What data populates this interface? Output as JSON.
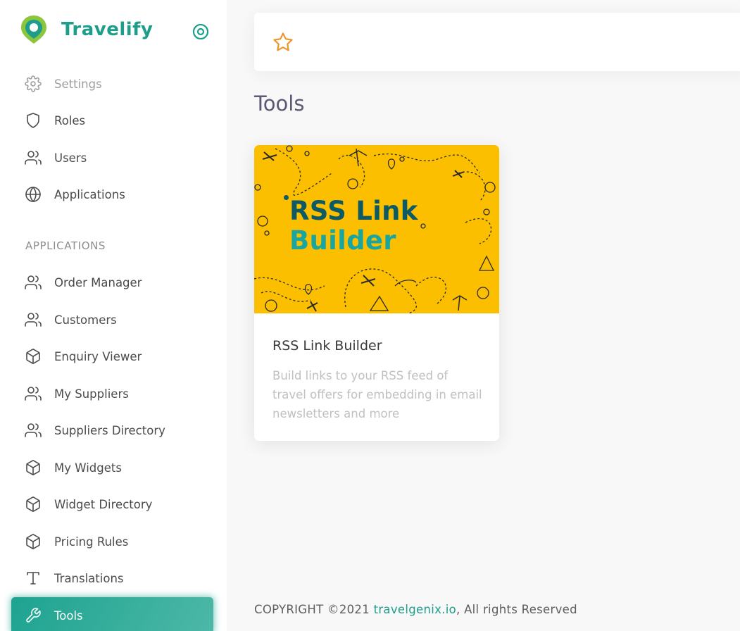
{
  "brand": {
    "name": "Travelify"
  },
  "colors": {
    "accent": "#1e9e8a",
    "card_image_bg": "#fbbf00",
    "star": "#f0932b"
  },
  "sidebar": {
    "section_header": "APPLICATIONS",
    "items": [
      {
        "label": "Settings",
        "icon": "gear-icon"
      },
      {
        "label": "Roles",
        "icon": "shield-icon"
      },
      {
        "label": "Users",
        "icon": "users-icon"
      },
      {
        "label": "Applications",
        "icon": "globe-icon"
      },
      {
        "label": "Order Manager",
        "icon": "users-icon"
      },
      {
        "label": "Customers",
        "icon": "users-icon"
      },
      {
        "label": "Enquiry Viewer",
        "icon": "box-icon"
      },
      {
        "label": "My Suppliers",
        "icon": "users-icon"
      },
      {
        "label": "Suppliers Directory",
        "icon": "users-icon"
      },
      {
        "label": "My Widgets",
        "icon": "box-icon"
      },
      {
        "label": "Widget Directory",
        "icon": "box-icon"
      },
      {
        "label": "Pricing Rules",
        "icon": "box-icon"
      },
      {
        "label": "Translations",
        "icon": "type-icon"
      },
      {
        "label": "Tools",
        "icon": "wrench-icon",
        "active": true
      }
    ]
  },
  "topbar": {
    "bookmark_icon": "star-icon"
  },
  "main": {
    "title": "Tools",
    "card": {
      "image_text_line1": "RSS Link",
      "image_text_line2": "Builder",
      "title": "RSS Link Builder",
      "description": "Build links to your RSS feed of travel offers for embedding in email newsletters and more"
    }
  },
  "footer": {
    "prefix": "COPYRIGHT ©2021 ",
    "link": "travelgenix.io",
    "suffix": ", All rights Reserved"
  }
}
